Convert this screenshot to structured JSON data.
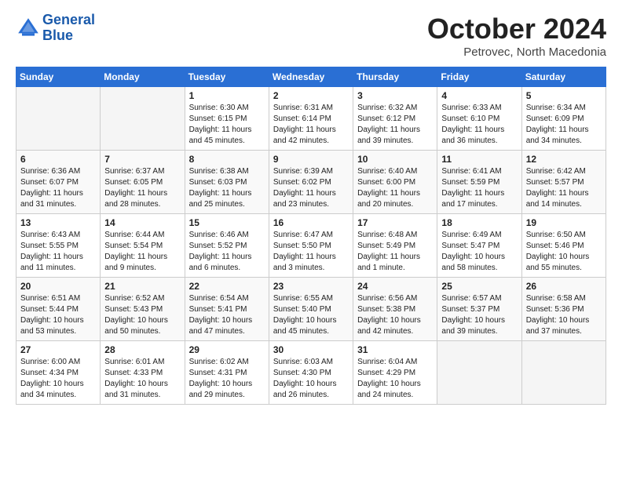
{
  "header": {
    "logo_line1": "General",
    "logo_line2": "Blue",
    "month": "October 2024",
    "location": "Petrovec, North Macedonia"
  },
  "weekdays": [
    "Sunday",
    "Monday",
    "Tuesday",
    "Wednesday",
    "Thursday",
    "Friday",
    "Saturday"
  ],
  "weeks": [
    [
      {
        "day": null
      },
      {
        "day": null
      },
      {
        "day": "1",
        "sunrise": "Sunrise: 6:30 AM",
        "sunset": "Sunset: 6:15 PM",
        "daylight": "Daylight: 11 hours and 45 minutes."
      },
      {
        "day": "2",
        "sunrise": "Sunrise: 6:31 AM",
        "sunset": "Sunset: 6:14 PM",
        "daylight": "Daylight: 11 hours and 42 minutes."
      },
      {
        "day": "3",
        "sunrise": "Sunrise: 6:32 AM",
        "sunset": "Sunset: 6:12 PM",
        "daylight": "Daylight: 11 hours and 39 minutes."
      },
      {
        "day": "4",
        "sunrise": "Sunrise: 6:33 AM",
        "sunset": "Sunset: 6:10 PM",
        "daylight": "Daylight: 11 hours and 36 minutes."
      },
      {
        "day": "5",
        "sunrise": "Sunrise: 6:34 AM",
        "sunset": "Sunset: 6:09 PM",
        "daylight": "Daylight: 11 hours and 34 minutes."
      }
    ],
    [
      {
        "day": "6",
        "sunrise": "Sunrise: 6:36 AM",
        "sunset": "Sunset: 6:07 PM",
        "daylight": "Daylight: 11 hours and 31 minutes."
      },
      {
        "day": "7",
        "sunrise": "Sunrise: 6:37 AM",
        "sunset": "Sunset: 6:05 PM",
        "daylight": "Daylight: 11 hours and 28 minutes."
      },
      {
        "day": "8",
        "sunrise": "Sunrise: 6:38 AM",
        "sunset": "Sunset: 6:03 PM",
        "daylight": "Daylight: 11 hours and 25 minutes."
      },
      {
        "day": "9",
        "sunrise": "Sunrise: 6:39 AM",
        "sunset": "Sunset: 6:02 PM",
        "daylight": "Daylight: 11 hours and 23 minutes."
      },
      {
        "day": "10",
        "sunrise": "Sunrise: 6:40 AM",
        "sunset": "Sunset: 6:00 PM",
        "daylight": "Daylight: 11 hours and 20 minutes."
      },
      {
        "day": "11",
        "sunrise": "Sunrise: 6:41 AM",
        "sunset": "Sunset: 5:59 PM",
        "daylight": "Daylight: 11 hours and 17 minutes."
      },
      {
        "day": "12",
        "sunrise": "Sunrise: 6:42 AM",
        "sunset": "Sunset: 5:57 PM",
        "daylight": "Daylight: 11 hours and 14 minutes."
      }
    ],
    [
      {
        "day": "13",
        "sunrise": "Sunrise: 6:43 AM",
        "sunset": "Sunset: 5:55 PM",
        "daylight": "Daylight: 11 hours and 11 minutes."
      },
      {
        "day": "14",
        "sunrise": "Sunrise: 6:44 AM",
        "sunset": "Sunset: 5:54 PM",
        "daylight": "Daylight: 11 hours and 9 minutes."
      },
      {
        "day": "15",
        "sunrise": "Sunrise: 6:46 AM",
        "sunset": "Sunset: 5:52 PM",
        "daylight": "Daylight: 11 hours and 6 minutes."
      },
      {
        "day": "16",
        "sunrise": "Sunrise: 6:47 AM",
        "sunset": "Sunset: 5:50 PM",
        "daylight": "Daylight: 11 hours and 3 minutes."
      },
      {
        "day": "17",
        "sunrise": "Sunrise: 6:48 AM",
        "sunset": "Sunset: 5:49 PM",
        "daylight": "Daylight: 11 hours and 1 minute."
      },
      {
        "day": "18",
        "sunrise": "Sunrise: 6:49 AM",
        "sunset": "Sunset: 5:47 PM",
        "daylight": "Daylight: 10 hours and 58 minutes."
      },
      {
        "day": "19",
        "sunrise": "Sunrise: 6:50 AM",
        "sunset": "Sunset: 5:46 PM",
        "daylight": "Daylight: 10 hours and 55 minutes."
      }
    ],
    [
      {
        "day": "20",
        "sunrise": "Sunrise: 6:51 AM",
        "sunset": "Sunset: 5:44 PM",
        "daylight": "Daylight: 10 hours and 53 minutes."
      },
      {
        "day": "21",
        "sunrise": "Sunrise: 6:52 AM",
        "sunset": "Sunset: 5:43 PM",
        "daylight": "Daylight: 10 hours and 50 minutes."
      },
      {
        "day": "22",
        "sunrise": "Sunrise: 6:54 AM",
        "sunset": "Sunset: 5:41 PM",
        "daylight": "Daylight: 10 hours and 47 minutes."
      },
      {
        "day": "23",
        "sunrise": "Sunrise: 6:55 AM",
        "sunset": "Sunset: 5:40 PM",
        "daylight": "Daylight: 10 hours and 45 minutes."
      },
      {
        "day": "24",
        "sunrise": "Sunrise: 6:56 AM",
        "sunset": "Sunset: 5:38 PM",
        "daylight": "Daylight: 10 hours and 42 minutes."
      },
      {
        "day": "25",
        "sunrise": "Sunrise: 6:57 AM",
        "sunset": "Sunset: 5:37 PM",
        "daylight": "Daylight: 10 hours and 39 minutes."
      },
      {
        "day": "26",
        "sunrise": "Sunrise: 6:58 AM",
        "sunset": "Sunset: 5:36 PM",
        "daylight": "Daylight: 10 hours and 37 minutes."
      }
    ],
    [
      {
        "day": "27",
        "sunrise": "Sunrise: 6:00 AM",
        "sunset": "Sunset: 4:34 PM",
        "daylight": "Daylight: 10 hours and 34 minutes."
      },
      {
        "day": "28",
        "sunrise": "Sunrise: 6:01 AM",
        "sunset": "Sunset: 4:33 PM",
        "daylight": "Daylight: 10 hours and 31 minutes."
      },
      {
        "day": "29",
        "sunrise": "Sunrise: 6:02 AM",
        "sunset": "Sunset: 4:31 PM",
        "daylight": "Daylight: 10 hours and 29 minutes."
      },
      {
        "day": "30",
        "sunrise": "Sunrise: 6:03 AM",
        "sunset": "Sunset: 4:30 PM",
        "daylight": "Daylight: 10 hours and 26 minutes."
      },
      {
        "day": "31",
        "sunrise": "Sunrise: 6:04 AM",
        "sunset": "Sunset: 4:29 PM",
        "daylight": "Daylight: 10 hours and 24 minutes."
      },
      {
        "day": null
      },
      {
        "day": null
      }
    ]
  ]
}
